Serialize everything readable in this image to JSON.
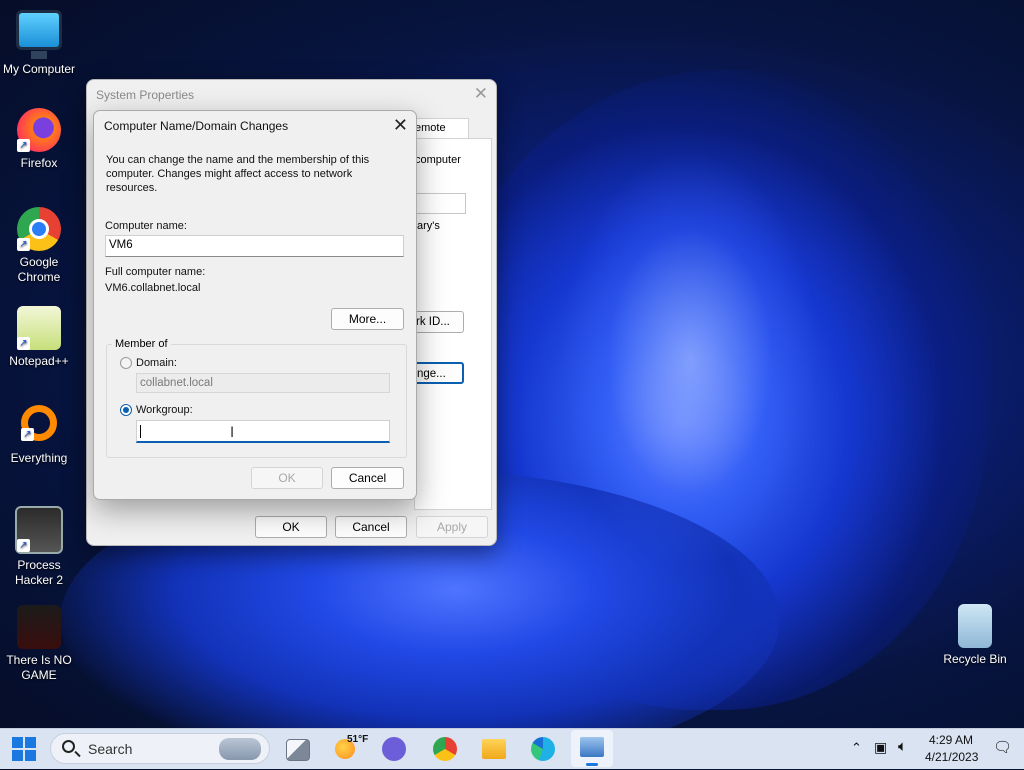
{
  "desktop": {
    "icons": [
      {
        "label": "My Computer"
      },
      {
        "label": "Firefox"
      },
      {
        "label": "Google Chrome"
      },
      {
        "label": "Notepad++"
      },
      {
        "label": "Everything"
      },
      {
        "label": "Process Hacker 2"
      },
      {
        "label": "There Is NO GAME"
      },
      {
        "label": "Recycle Bin"
      }
    ]
  },
  "system_properties": {
    "title": "System Properties",
    "visible_tab": "emote",
    "bg_text_1": "computer",
    "bg_text_2": "ary's",
    "bg_button_network_id": "rk ID...",
    "bg_button_change": "nge...",
    "buttons": {
      "ok": "OK",
      "cancel": "Cancel",
      "apply": "Apply"
    }
  },
  "name_dialog": {
    "title": "Computer Name/Domain Changes",
    "description": "You can change the name and the membership of this computer. Changes might affect access to network resources.",
    "computer_name_label": "Computer name:",
    "computer_name_value": "VM6",
    "full_name_label": "Full computer name:",
    "full_name_value": "VM6.collabnet.local",
    "more_button": "More...",
    "member_of_label": "Member of",
    "domain_label": "Domain:",
    "domain_value": "collabnet.local",
    "workgroup_label": "Workgroup:",
    "workgroup_value": "",
    "selected": "workgroup",
    "ok_button": "OK",
    "cancel_button": "Cancel"
  },
  "taskbar": {
    "search_label": "Search",
    "weather_temp": "51°F",
    "time": "4:29 AM",
    "date": "4/21/2023"
  }
}
